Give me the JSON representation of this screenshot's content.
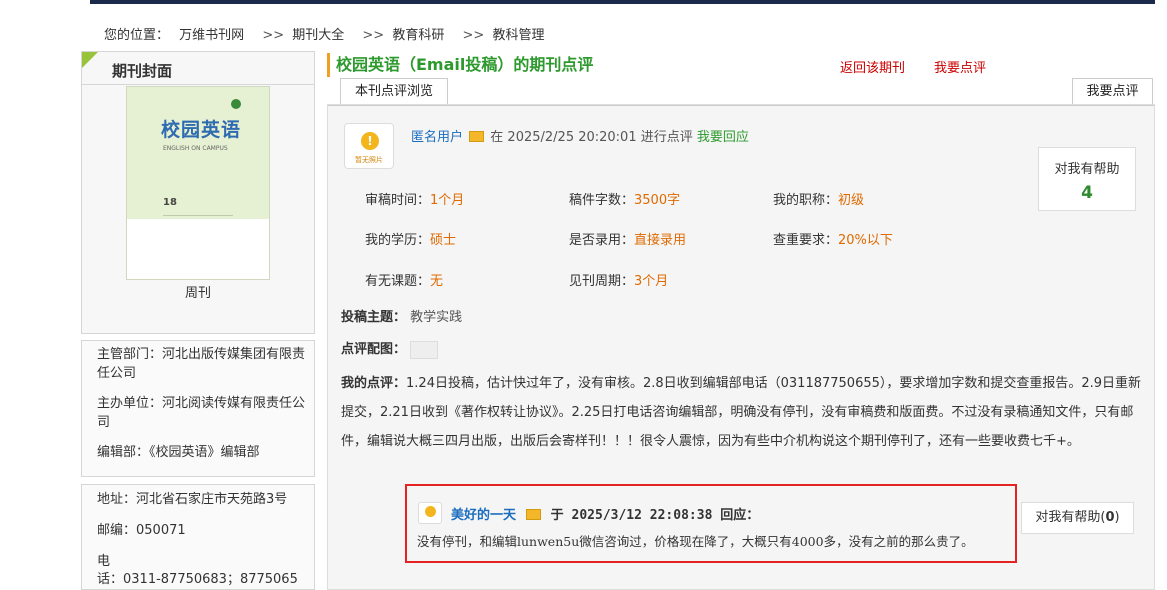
{
  "breadcrumb": {
    "prefix": "您的位置：",
    "items": [
      "万维书刊网",
      "期刊大全",
      "教育科研",
      "教科管理"
    ],
    "separator": ">>"
  },
  "sidebar": {
    "cover_title": "期刊封面",
    "cover_caption": "周刊",
    "cover_image": {
      "title": "校园英语",
      "subtitle": "ENGLISH ON CAMPUS",
      "issue": "18"
    },
    "info": {
      "supervisor": "主管部门：河北出版传媒集团有限责任公司",
      "sponsor": "主办单位：河北阅读传媒有限责任公司",
      "editor": "编辑部：《校园英语》编辑部"
    },
    "contact": {
      "address": "地址：河北省石家庄市天苑路3号",
      "postcode": "邮编：050071",
      "phone_label": "电",
      "phone": "话：0311-87750683；8775065"
    }
  },
  "main": {
    "page_title": "校园英语（Email投稿）的期刊点评",
    "link_back": "返回该期刊",
    "link_review": "我要点评",
    "tab_browse": "本刊点评浏览",
    "tab_review": "我要点评",
    "review": {
      "avatar_label": "暂无照片",
      "user": "匿名用户",
      "time_text": "在 2025/2/25 20:20:01 进行点评",
      "reply_link": "我要回应",
      "help_label": "对我有帮助",
      "help_count": "4",
      "fields": [
        {
          "label": "审稿时间：",
          "value": "1个月"
        },
        {
          "label": "稿件字数：",
          "value": "3500字"
        },
        {
          "label": "我的职称：",
          "value": "初级"
        },
        {
          "label": "我的学历：",
          "value": "硕士"
        },
        {
          "label": "是否录用：",
          "value": "直接录用"
        },
        {
          "label": "查重要求：",
          "value": "20%以下"
        },
        {
          "label": "有无课题：",
          "value": "无"
        },
        {
          "label": "见刊周期：",
          "value": "3个月"
        }
      ],
      "topic_label": "投稿主题：",
      "topic_value": "教学实践",
      "image_label": "点评配图：",
      "comment_label": "我的点评：",
      "comment_text": "1.24日投稿，估计快过年了，没有审核。2.8日收到编辑部电话（031187750655），要求增加字数和提交查重报告。2.9日重新提交，2.21日收到《著作权转让协议》。2.25日打电话咨询编辑部，明确没有停刊，没有审稿费和版面费。不过没有录稿通知文件，只有邮件，编辑说大概三四月出版，出版后会寄样刊！！！很令人震惊，因为有些中介机构说这个期刊停刊了，还有一些要收费七千+。"
    },
    "reply": {
      "user": "美好的一天",
      "text_prefix": "于",
      "time": "2025/3/12 22:08:38",
      "suffix": "回应：",
      "body": "没有停刊，和编辑lunwen5u微信咨询过，价格现在降了，大概只有4000多，没有之前的那么贵了。",
      "help_label": "对我有帮助",
      "help_count": "0"
    }
  }
}
